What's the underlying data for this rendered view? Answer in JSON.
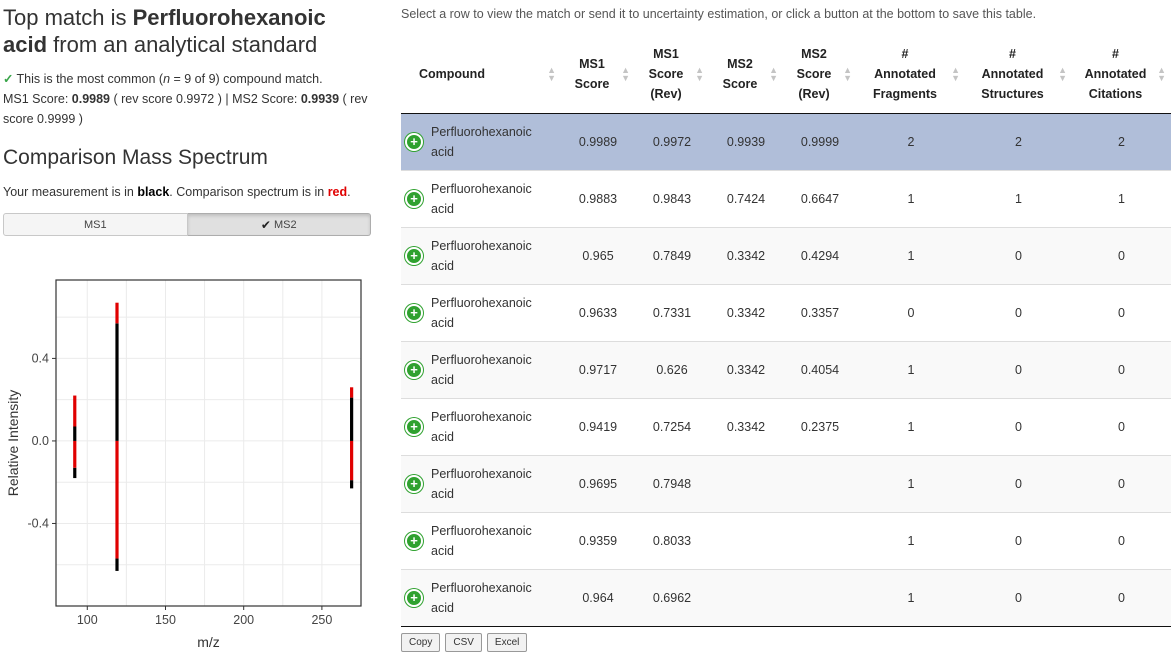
{
  "summary": {
    "title_prefix": "Top match is ",
    "compound": "Perfluorohexanoic acid",
    "title_suffix": " from an analytical standard",
    "common_prefix": "This is the most common (",
    "n_label": "n",
    "common_count": " = 9 of 9",
    "common_suffix": ") compound match.",
    "ms1_label": "MS1 Score: ",
    "ms1_score": "0.9989",
    "ms1_rev": " ( rev score 0.9972 ) | ",
    "ms2_label": "MS2 Score: ",
    "ms2_score": "0.9939",
    "ms2_rev": " ( rev score 0.9999 )"
  },
  "spectrum": {
    "section_title": "Comparison Mass Spectrum",
    "legend_prefix": "Your measurement is in ",
    "legend_black": "black",
    "legend_middle": ". Comparison spectrum is in ",
    "legend_red": "red",
    "legend_end": ".",
    "toggle": [
      "MS1",
      "MS2"
    ],
    "active_toggle": "MS2",
    "colors": {
      "measured": "#000000",
      "comparison": "#e00000"
    }
  },
  "chart_data": {
    "type": "bar",
    "xlabel": "m/z",
    "ylabel": "Relative Intensity",
    "xlim": [
      80,
      275
    ],
    "ylim": [
      -0.8,
      0.78
    ],
    "xticks": [
      100,
      150,
      200,
      250
    ],
    "yticks": [
      -0.4,
      0.0,
      0.4
    ],
    "ytick_labels": [
      "-0.4",
      "0.0",
      "0.4"
    ],
    "grid": true,
    "bars": [
      {
        "mz": 92,
        "segments": [
          [
            -0.18,
            -0.13,
            "measured"
          ],
          [
            -0.13,
            0.0,
            "comparison"
          ],
          [
            0.0,
            0.07,
            "measured"
          ],
          [
            0.07,
            0.22,
            "comparison"
          ]
        ]
      },
      {
        "mz": 119,
        "segments": [
          [
            -0.63,
            -0.57,
            "measured"
          ],
          [
            -0.57,
            0.0,
            "comparison"
          ],
          [
            0.0,
            0.57,
            "measured"
          ],
          [
            0.57,
            0.67,
            "comparison"
          ]
        ]
      },
      {
        "mz": 269,
        "segments": [
          [
            -0.23,
            -0.19,
            "measured"
          ],
          [
            -0.19,
            0.0,
            "comparison"
          ],
          [
            0.0,
            0.21,
            "measured"
          ],
          [
            0.21,
            0.26,
            "comparison"
          ]
        ]
      }
    ]
  },
  "table": {
    "instructions": "Select a row to view the match or send it to uncertainty estimation, or click a button at the bottom to save this table.",
    "columns": [
      [
        "Compound"
      ],
      [
        "MS1",
        "Score"
      ],
      [
        "MS1",
        "Score",
        "(Rev)"
      ],
      [
        "MS2",
        "Score"
      ],
      [
        "MS2",
        "Score",
        "(Rev)"
      ],
      [
        "#",
        "Annotated",
        "Fragments"
      ],
      [
        "#",
        "Annotated",
        "Structures"
      ],
      [
        "#",
        "Annotated",
        "Citations"
      ]
    ],
    "rows": [
      [
        "Perfluorohexanoic acid",
        "0.9989",
        "0.9972",
        "0.9939",
        "0.9999",
        "2",
        "2",
        "2"
      ],
      [
        "Perfluorohexanoic acid",
        "0.9883",
        "0.9843",
        "0.7424",
        "0.6647",
        "1",
        "1",
        "1"
      ],
      [
        "Perfluorohexanoic acid",
        "0.965",
        "0.7849",
        "0.3342",
        "0.4294",
        "1",
        "0",
        "0"
      ],
      [
        "Perfluorohexanoic acid",
        "0.9633",
        "0.7331",
        "0.3342",
        "0.3357",
        "0",
        "0",
        "0"
      ],
      [
        "Perfluorohexanoic acid",
        "0.9717",
        "0.626",
        "0.3342",
        "0.4054",
        "1",
        "0",
        "0"
      ],
      [
        "Perfluorohexanoic acid",
        "0.9419",
        "0.7254",
        "0.3342",
        "0.2375",
        "1",
        "0",
        "0"
      ],
      [
        "Perfluorohexanoic acid",
        "0.9695",
        "0.7948",
        "",
        "",
        "1",
        "0",
        "0"
      ],
      [
        "Perfluorohexanoic acid",
        "0.9359",
        "0.8033",
        "",
        "",
        "1",
        "0",
        "0"
      ],
      [
        "Perfluorohexanoic acid",
        "0.964",
        "0.6962",
        "",
        "",
        "1",
        "0",
        "0"
      ]
    ],
    "selected_row": 0,
    "export_buttons": [
      "Copy",
      "CSV",
      "Excel"
    ]
  }
}
